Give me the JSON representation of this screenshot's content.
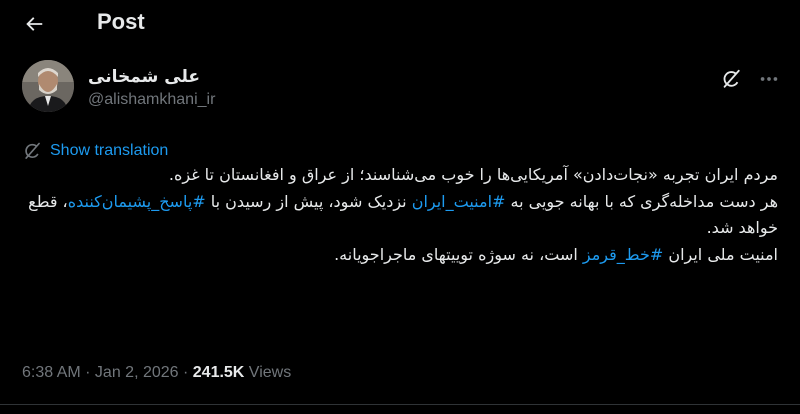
{
  "header": {
    "title": "Post"
  },
  "author": {
    "display_name": "علی شمخانی",
    "handle": "@alishamkhani_ir"
  },
  "translation": {
    "label": "Show translation"
  },
  "tweet": {
    "paragraph1": "مردم ایران تجربه «نجات‌دادن» آمریکایی‌ها را خوب می‌شناسند؛ از عراق و افغانستان تا غزه.",
    "paragraph2_a": "هر دست مداخله‌گری که با بهانه جویی به ",
    "hashtag1": "#امنیت_ایران",
    "paragraph2_b": " نزدیک شود، پیش از رسیدن با ",
    "hashtag2": "#پاسخ_پشیمان‌کننده",
    "paragraph2_c": "، قطع خواهد شد.",
    "paragraph3_a": "امنیت ملی ایران ",
    "hashtag3": "#خط_قرمز",
    "paragraph3_b": " است، نه سوژه توییتهای ماجراجویانه."
  },
  "meta": {
    "time": "6:38 AM",
    "separator": " · ",
    "date": "Jan 2, 2026",
    "views_separator": " · ",
    "views_count": "241.5K",
    "views_label": " Views"
  },
  "icons": {
    "back": "arrow-left-icon",
    "grok": "grok-icon",
    "more": "more-horizontal-icon",
    "translate": "translate-icon"
  },
  "colors": {
    "background": "#000000",
    "text": "#e7e9ea",
    "secondary": "#71767b",
    "accent": "#1d9bf0"
  }
}
